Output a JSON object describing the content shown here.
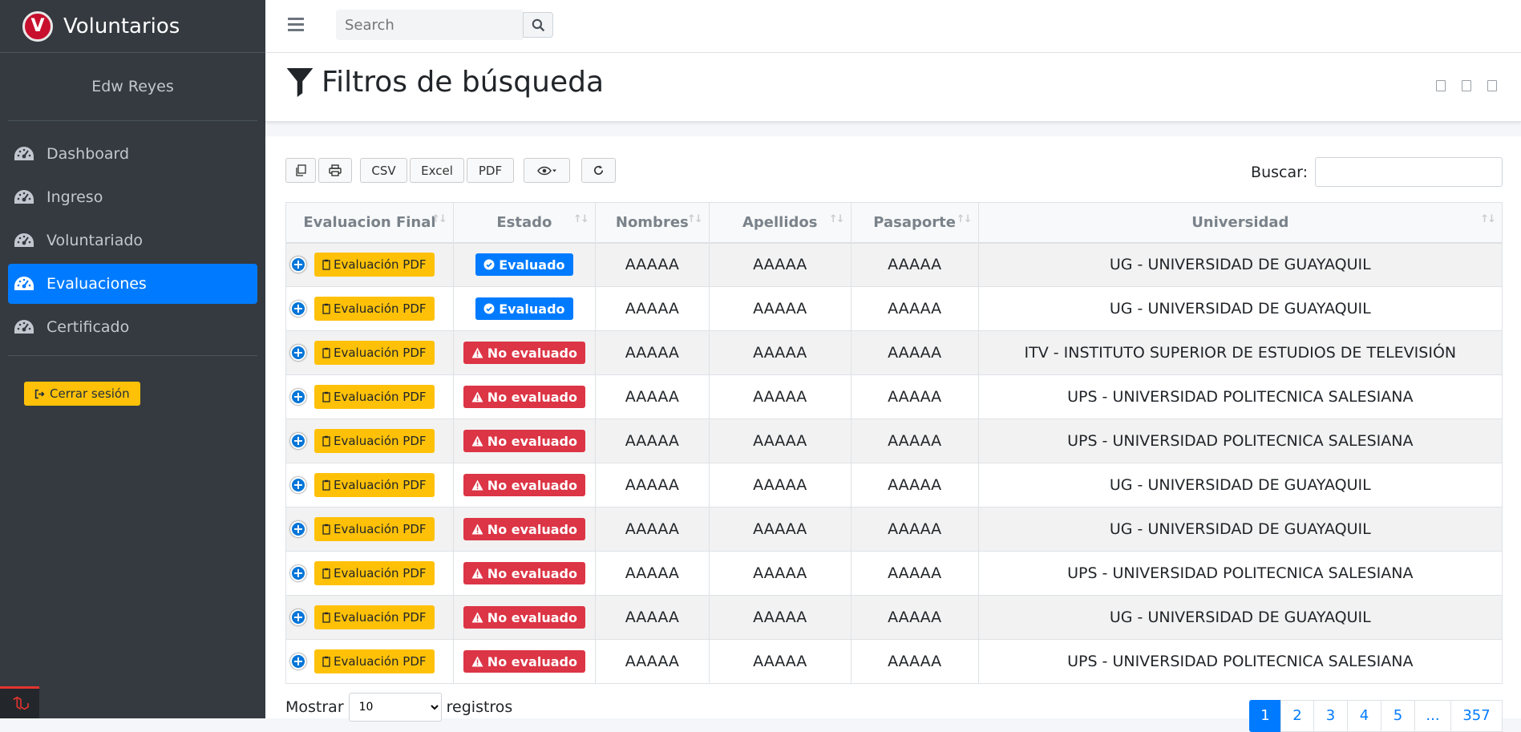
{
  "brand": {
    "name": "Voluntarios",
    "logo_letter": "V"
  },
  "user": {
    "name": "Edw Reyes"
  },
  "sidebar": {
    "items": [
      {
        "label": "Dashboard",
        "icon": "tachometer-icon",
        "active": false
      },
      {
        "label": "Ingreso",
        "icon": "tachometer-icon",
        "active": false
      },
      {
        "label": "Voluntariado",
        "icon": "tachometer-icon",
        "active": false
      },
      {
        "label": "Evaluaciones",
        "icon": "tachometer-icon",
        "active": true
      },
      {
        "label": "Certificado",
        "icon": "tachometer-icon",
        "active": false
      }
    ],
    "logout_label": "Cerrar sesión"
  },
  "topbar": {
    "search_placeholder": "Search"
  },
  "header": {
    "title": "Filtros de búsqueda"
  },
  "toolbar": {
    "csv": "CSV",
    "excel": "Excel",
    "pdf": "PDF"
  },
  "search": {
    "label": "Buscar:"
  },
  "table": {
    "columns": [
      "Evaluacion Final",
      "Estado",
      "Nombres",
      "Apellidos",
      "Pasaporte",
      "Universidad"
    ],
    "pdf_label": "Evaluación PDF",
    "rows": [
      {
        "estado": "Evaluado",
        "evaluated": true,
        "nombres": "AAAAA",
        "apellidos": "AAAAA",
        "pasaporte": "AAAAA",
        "universidad": "UG - UNIVERSIDAD DE GUAYAQUIL"
      },
      {
        "estado": "Evaluado",
        "evaluated": true,
        "nombres": "AAAAA",
        "apellidos": "AAAAA",
        "pasaporte": "AAAAA",
        "universidad": "UG - UNIVERSIDAD DE GUAYAQUIL"
      },
      {
        "estado": "No evaluado",
        "evaluated": false,
        "nombres": "AAAAA",
        "apellidos": "AAAAA",
        "pasaporte": "AAAAA",
        "universidad": "ITV - INSTITUTO SUPERIOR DE ESTUDIOS DE TELEVISIÓN"
      },
      {
        "estado": "No evaluado",
        "evaluated": false,
        "nombres": "AAAAA",
        "apellidos": "AAAAA",
        "pasaporte": "AAAAA",
        "universidad": "UPS - UNIVERSIDAD POLITECNICA SALESIANA"
      },
      {
        "estado": "No evaluado",
        "evaluated": false,
        "nombres": "AAAAA",
        "apellidos": "AAAAA",
        "pasaporte": "AAAAA",
        "universidad": "UPS - UNIVERSIDAD POLITECNICA SALESIANA"
      },
      {
        "estado": "No evaluado",
        "evaluated": false,
        "nombres": "AAAAA",
        "apellidos": "AAAAA",
        "pasaporte": "AAAAA",
        "universidad": "UG - UNIVERSIDAD DE GUAYAQUIL"
      },
      {
        "estado": "No evaluado",
        "evaluated": false,
        "nombres": "AAAAA",
        "apellidos": "AAAAA",
        "pasaporte": "AAAAA",
        "universidad": "UG - UNIVERSIDAD DE GUAYAQUIL"
      },
      {
        "estado": "No evaluado",
        "evaluated": false,
        "nombres": "AAAAA",
        "apellidos": "AAAAA",
        "pasaporte": "AAAAA",
        "universidad": "UPS - UNIVERSIDAD POLITECNICA SALESIANA"
      },
      {
        "estado": "No evaluado",
        "evaluated": false,
        "nombres": "AAAAA",
        "apellidos": "AAAAA",
        "pasaporte": "AAAAA",
        "universidad": "UG - UNIVERSIDAD DE GUAYAQUIL"
      },
      {
        "estado": "No evaluado",
        "evaluated": false,
        "nombres": "AAAAA",
        "apellidos": "AAAAA",
        "pasaporte": "AAAAA",
        "universidad": "UPS - UNIVERSIDAD POLITECNICA SALESIANA"
      }
    ]
  },
  "length": {
    "prefix": "Mostrar",
    "value": "10",
    "suffix": "registros"
  },
  "pagination": {
    "pages": [
      "1",
      "2",
      "3",
      "4",
      "5",
      "...",
      "357"
    ],
    "current": "1"
  },
  "colors": {
    "primary": "#007bff",
    "warning": "#ffc107",
    "danger": "#dc3545",
    "sidebar_bg": "#343a40"
  }
}
